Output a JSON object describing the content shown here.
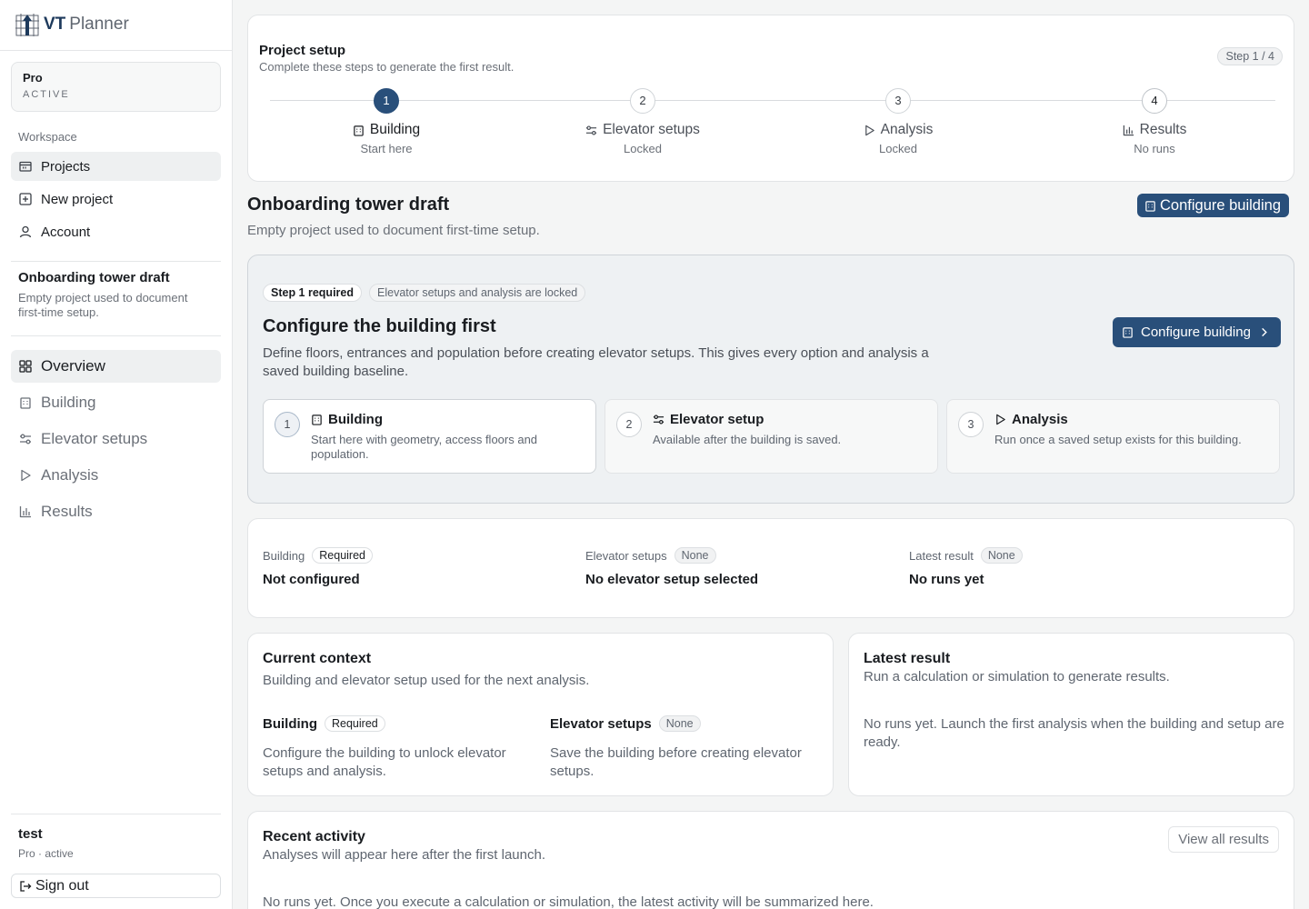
{
  "app": {
    "name_part1": "VT",
    "name_part2": "Planner"
  },
  "plan": {
    "name": "Pro",
    "status": "ACTIVE"
  },
  "workspace": {
    "label": "Workspace",
    "items": [
      {
        "label": "Projects",
        "icon": "folder-icon"
      },
      {
        "label": "New project",
        "icon": "plus-square-icon"
      },
      {
        "label": "Account",
        "icon": "user-icon"
      }
    ]
  },
  "current_project": {
    "title": "Onboarding tower draft",
    "description": "Empty project used to document first-time setup."
  },
  "sections": [
    {
      "label": "Overview",
      "icon": "grid-icon"
    },
    {
      "label": "Building",
      "icon": "building-icon"
    },
    {
      "label": "Elevator setups",
      "icon": "sliders-icon"
    },
    {
      "label": "Analysis",
      "icon": "play-icon"
    },
    {
      "label": "Results",
      "icon": "bar-chart-icon"
    }
  ],
  "user": {
    "name": "test",
    "sub": "Pro · active",
    "signout": "Sign out"
  },
  "setup": {
    "title": "Project setup",
    "subtitle": "Complete these steps to generate the first result.",
    "step_badge": "Step 1 / 4",
    "steps": [
      {
        "num": "1",
        "label": "Building",
        "sub": "Start here"
      },
      {
        "num": "2",
        "label": "Elevator setups",
        "sub": "Locked"
      },
      {
        "num": "3",
        "label": "Analysis",
        "sub": "Locked"
      },
      {
        "num": "4",
        "label": "Results",
        "sub": "No runs"
      }
    ]
  },
  "project": {
    "title": "Onboarding tower draft",
    "description": "Empty project used to document first-time setup.",
    "configure_btn": "Configure building"
  },
  "hero": {
    "badge1": "Step 1 required",
    "badge2": "Elevator setups and analysis are locked",
    "title": "Configure the building first",
    "description": "Define floors, entrances and population before creating elevator setups. This gives every option and analysis a saved building baseline.",
    "button": "Configure building",
    "options": [
      {
        "num": "1",
        "title": "Building",
        "desc": "Start here with geometry, access floors and population."
      },
      {
        "num": "2",
        "title": "Elevator setup",
        "desc": "Available after the building is saved."
      },
      {
        "num": "3",
        "title": "Analysis",
        "desc": "Run once a saved setup exists for this building."
      }
    ]
  },
  "summary": [
    {
      "label": "Building",
      "badge": "Required",
      "value": "Not configured"
    },
    {
      "label": "Elevator setups",
      "badge": "None",
      "value": "No elevator setup selected"
    },
    {
      "label": "Latest result",
      "badge": "None",
      "value": "No runs yet"
    }
  ],
  "context": {
    "title": "Current context",
    "subtitle": "Building and elevator setup used for the next analysis.",
    "building": {
      "label": "Building",
      "badge": "Required",
      "text": "Configure the building to unlock elevator setups and analysis."
    },
    "elevators": {
      "label": "Elevator setups",
      "badge": "None",
      "text": "Save the building before creating elevator setups."
    }
  },
  "latest": {
    "title": "Latest result",
    "subtitle": "Run a calculation or simulation to generate results.",
    "text": "No runs yet. Launch the first analysis when the building and setup are ready."
  },
  "activity": {
    "title": "Recent activity",
    "subtitle": "Analyses will appear here after the first launch.",
    "button": "View all results",
    "text": "No runs yet. Once you execute a calculation or simulation, the latest activity will be summarized here."
  }
}
